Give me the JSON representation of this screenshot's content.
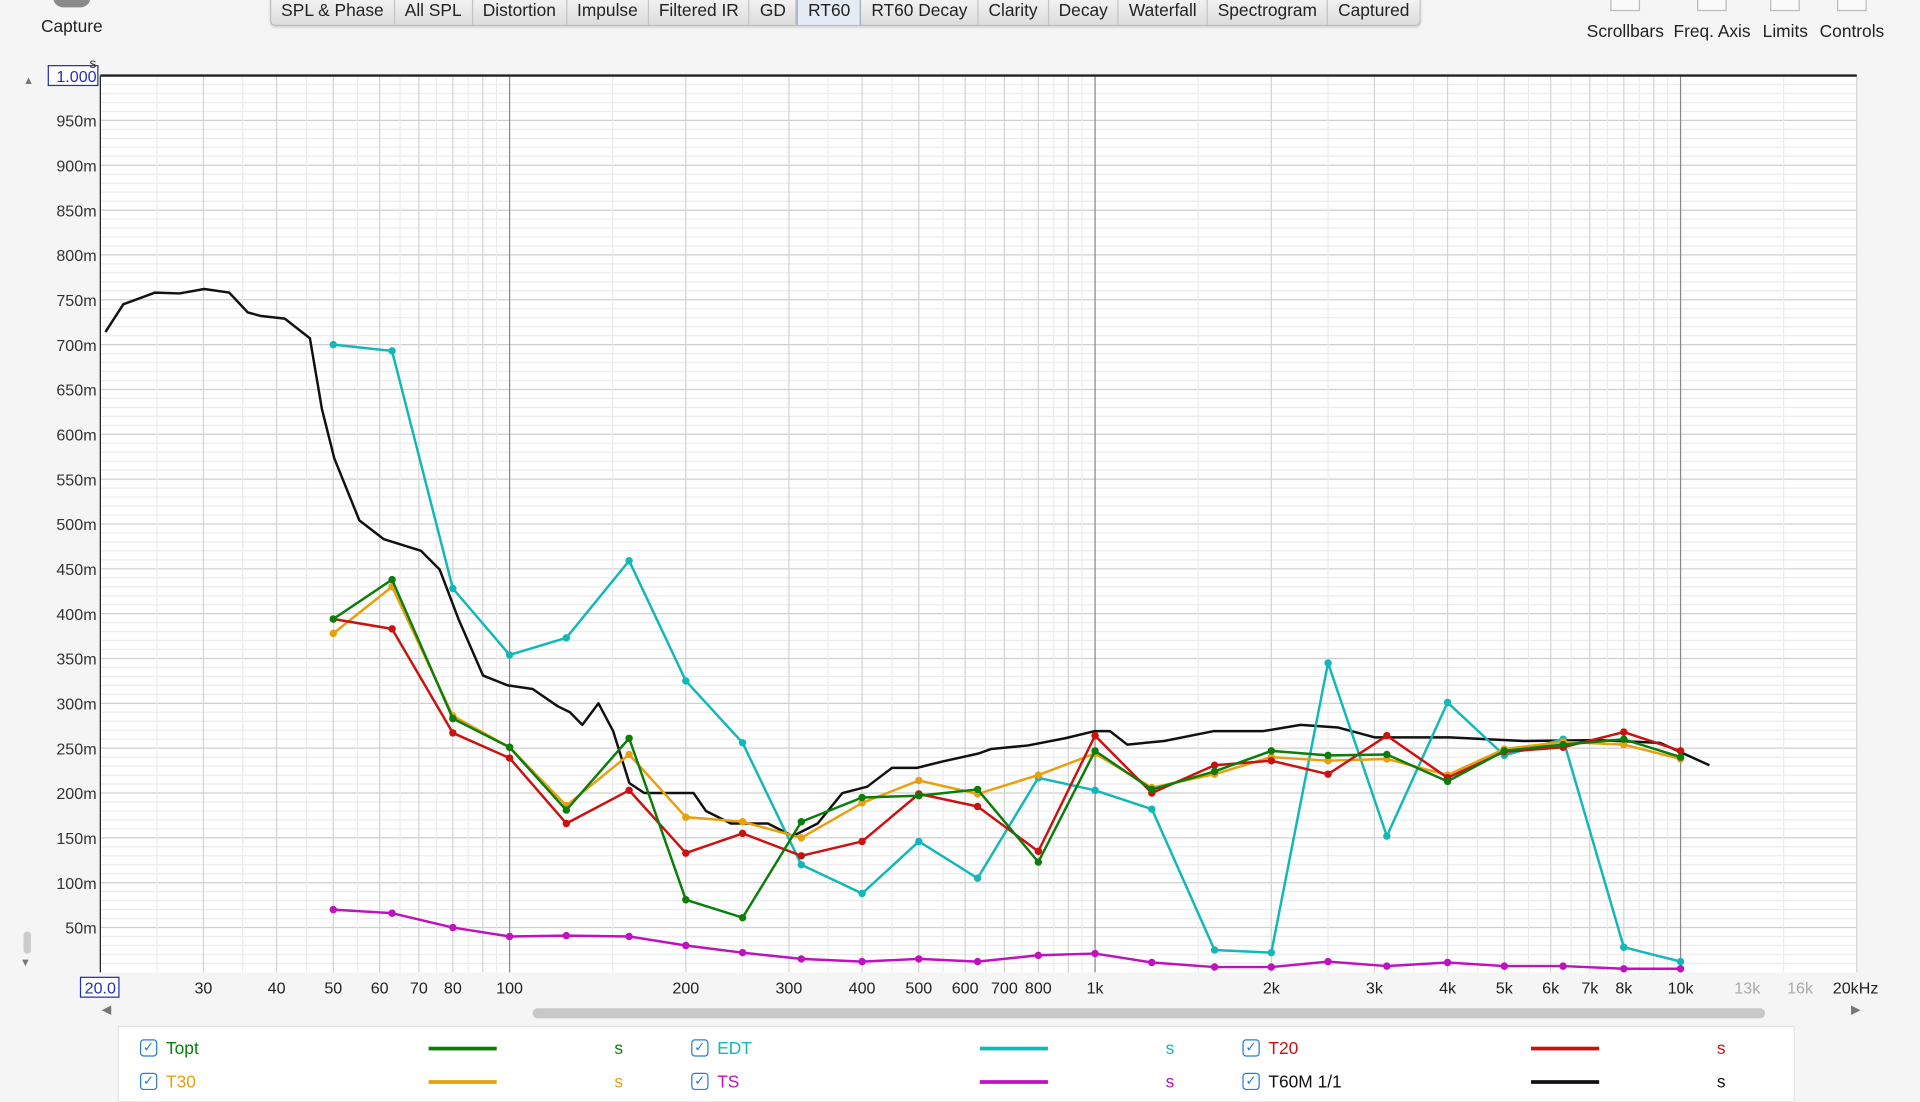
{
  "toolbar": {
    "capture_label": "Capture",
    "tabs": [
      "SPL & Phase",
      "All SPL",
      "Distortion",
      "Impulse",
      "Filtered IR",
      "GD",
      "RT60",
      "RT60 Decay",
      "Clarity",
      "Decay",
      "Waterfall",
      "Spectrogram",
      "Captured"
    ],
    "active_tab": "RT60",
    "right_tools": [
      "Scrollbars",
      "Freq. Axis",
      "Limits",
      "Controls"
    ]
  },
  "chart_data": {
    "type": "line",
    "ylabel": "s",
    "ylim": [
      0,
      1.0
    ],
    "xlim": [
      20,
      20000
    ],
    "xscale": "log",
    "yticks": [
      "1.000",
      "950m",
      "900m",
      "850m",
      "800m",
      "750m",
      "700m",
      "650m",
      "600m",
      "550m",
      "500m",
      "450m",
      "400m",
      "350m",
      "300m",
      "250m",
      "200m",
      "150m",
      "100m",
      "50m"
    ],
    "xticks": [
      {
        "f": 20,
        "label": "20.0"
      },
      {
        "f": 30,
        "label": "30"
      },
      {
        "f": 40,
        "label": "40"
      },
      {
        "f": 50,
        "label": "50"
      },
      {
        "f": 60,
        "label": "60"
      },
      {
        "f": 70,
        "label": "70"
      },
      {
        "f": 80,
        "label": "80"
      },
      {
        "f": 100,
        "label": "100"
      },
      {
        "f": 200,
        "label": "200"
      },
      {
        "f": 300,
        "label": "300"
      },
      {
        "f": 400,
        "label": "400"
      },
      {
        "f": 500,
        "label": "500"
      },
      {
        "f": 600,
        "label": "600"
      },
      {
        "f": 700,
        "label": "700"
      },
      {
        "f": 800,
        "label": "800"
      },
      {
        "f": 1000,
        "label": "1k"
      },
      {
        "f": 2000,
        "label": "2k"
      },
      {
        "f": 3000,
        "label": "3k"
      },
      {
        "f": 4000,
        "label": "4k"
      },
      {
        "f": 5000,
        "label": "5k"
      },
      {
        "f": 6000,
        "label": "6k"
      },
      {
        "f": 7000,
        "label": "7k"
      },
      {
        "f": 8000,
        "label": "8k"
      },
      {
        "f": 10000,
        "label": "10k"
      },
      {
        "f": 13000,
        "label": "13k",
        "dim": true
      },
      {
        "f": 16000,
        "label": "16k",
        "dim": true
      },
      {
        "f": 20000,
        "label": "20kHz"
      }
    ],
    "bands": [
      50,
      63,
      80,
      100,
      125,
      160,
      200,
      250,
      315,
      400,
      500,
      630,
      800,
      1000,
      1250,
      1600,
      2000,
      2500,
      3150,
      4000,
      5000,
      6300,
      8000,
      10000
    ],
    "series": [
      {
        "name": "Topt",
        "unit": "s",
        "color": "#0a7d0a",
        "markers": true,
        "values": [
          0.394,
          0.438,
          0.283,
          0.251,
          0.181,
          0.261,
          0.081,
          0.061,
          0.168,
          0.195,
          0.197,
          0.204,
          0.123,
          0.247,
          0.204,
          0.224,
          0.247,
          0.242,
          0.243,
          0.213,
          0.247,
          0.254,
          0.26,
          0.24
        ]
      },
      {
        "name": "EDT",
        "unit": "s",
        "color": "#12b8b8",
        "markers": true,
        "values": [
          0.7,
          0.693,
          0.428,
          0.354,
          0.373,
          0.459,
          0.325,
          0.256,
          0.12,
          0.088,
          0.146,
          0.105,
          0.217,
          0.203,
          0.182,
          0.025,
          0.022,
          0.345,
          0.152,
          0.301,
          0.242,
          0.26,
          0.028,
          0.012
        ]
      },
      {
        "name": "T20",
        "unit": "s",
        "color": "#cc1111",
        "markers": true,
        "values": [
          0.394,
          0.383,
          0.267,
          0.239,
          0.166,
          0.203,
          0.133,
          0.155,
          0.13,
          0.146,
          0.199,
          0.185,
          0.135,
          0.264,
          0.2,
          0.231,
          0.236,
          0.221,
          0.264,
          0.217,
          0.246,
          0.251,
          0.268,
          0.247
        ]
      },
      {
        "name": "T30",
        "unit": "s",
        "color": "#e8a010",
        "markers": true,
        "values": [
          0.378,
          0.43,
          0.286,
          0.251,
          0.186,
          0.243,
          0.173,
          0.168,
          0.15,
          0.189,
          0.214,
          0.199,
          0.22,
          0.244,
          0.206,
          0.221,
          0.24,
          0.236,
          0.238,
          0.22,
          0.249,
          0.257,
          0.254,
          0.238
        ]
      },
      {
        "name": "TS",
        "unit": "s",
        "color": "#c010c0",
        "markers": true,
        "values": [
          0.07,
          0.066,
          0.05,
          0.04,
          0.041,
          0.04,
          0.03,
          0.022,
          0.015,
          0.012,
          0.015,
          0.012,
          0.019,
          0.021,
          0.011,
          0.006,
          0.006,
          0.012,
          0.007,
          0.011,
          0.007,
          0.007,
          0.004,
          0.004
        ]
      },
      {
        "name": "T60M 1/1",
        "unit": "s",
        "color": "#111111",
        "markers": false,
        "freqs": [
          20.4,
          21.9,
          24.8,
          27.3,
          30.1,
          33.2,
          35.7,
          37.5,
          41.3,
          45.6,
          47.8,
          50.2,
          55.4,
          61.0,
          70.6,
          76.0,
          81.8,
          90.1,
          99.3,
          109.5,
          120.7,
          126.8,
          133.1,
          141.8,
          150.3,
          160.2,
          169.8,
          187.2,
          206.2,
          216.5,
          238.8,
          276.2,
          304.6,
          335.9,
          370.3,
          408.2,
          450,
          496.2,
          546.9,
          632.6,
          664,
          768,
          889,
          1000,
          1060,
          1135,
          1313,
          1596,
          1939,
          2244,
          2597,
          3007,
          4028,
          5395,
          7227,
          9226,
          11200
        ],
        "values": [
          0.714,
          0.745,
          0.758,
          0.757,
          0.762,
          0.758,
          0.736,
          0.732,
          0.729,
          0.707,
          0.628,
          0.573,
          0.504,
          0.483,
          0.47,
          0.449,
          0.394,
          0.331,
          0.32,
          0.316,
          0.297,
          0.29,
          0.276,
          0.3,
          0.269,
          0.211,
          0.2,
          0.2,
          0.2,
          0.18,
          0.166,
          0.166,
          0.152,
          0.166,
          0.2,
          0.207,
          0.228,
          0.228,
          0.235,
          0.244,
          0.249,
          0.253,
          0.261,
          0.269,
          0.269,
          0.254,
          0.258,
          0.269,
          0.269,
          0.276,
          0.273,
          0.262,
          0.262,
          0.258,
          0.259,
          0.256,
          0.231
        ]
      }
    ]
  }
}
